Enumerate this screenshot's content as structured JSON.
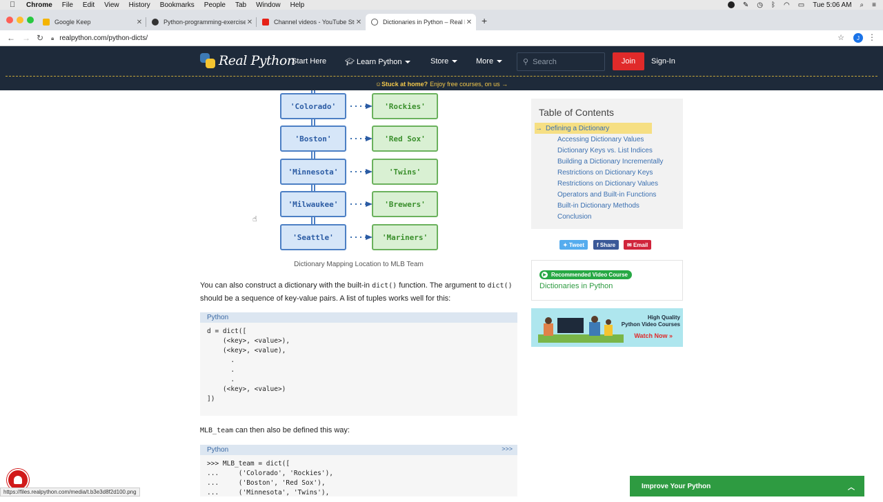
{
  "menubar": {
    "app": "Chrome",
    "items": [
      "File",
      "Edit",
      "View",
      "History",
      "Bookmarks",
      "People",
      "Tab",
      "Window",
      "Help"
    ],
    "clock": "Tue 5:06 AM"
  },
  "tabs": [
    {
      "title": "Google Keep",
      "color": "#f4b400"
    },
    {
      "title": "Python-programming-exercise",
      "color": "#333333"
    },
    {
      "title": "Channel videos - YouTube Stud",
      "color": "#e62117"
    },
    {
      "title": "Dictionaries in Python – Real P",
      "color": "#555555"
    }
  ],
  "address": {
    "url": "realpython.com/python-dicts/",
    "avatar": "J"
  },
  "site": {
    "logo": "Real Python",
    "nav": [
      "Start Here",
      "Learn Python",
      "Store",
      "More"
    ],
    "search_placeholder": "Search",
    "join": "Join",
    "signin": "Sign-In",
    "promo_bold": "Stuck at home?",
    "promo_text": "Enjoy free courses, on us →"
  },
  "diagram": {
    "keys": [
      "'Colorado'",
      "'Boston'",
      "'Minnesota'",
      "'Milwaukee'",
      "'Seattle'"
    ],
    "values": [
      "'Rockies'",
      "'Red Sox'",
      "'Twins'",
      "'Brewers'",
      "'Mariners'"
    ],
    "caption": "Dictionary Mapping Location to MLB Team"
  },
  "para1": {
    "a": "You can also construct a dictionary with the built-in ",
    "code1": "dict()",
    "b": " function. The argument to ",
    "code2": "dict()",
    "c": " should be a sequence of key-value pairs. A list of tuples works well for this:"
  },
  "code1": {
    "lang": "Python",
    "lines": [
      "d = dict([",
      "    (<key>, <value>),",
      "    (<key>, <value),",
      "      .",
      "      .",
      "      .",
      "    (<key>, <value>)",
      "])"
    ]
  },
  "para2": {
    "code": "MLB_team",
    "text": " can then also be defined this way:"
  },
  "code2": {
    "lang": "Python",
    "prompt": ">>>",
    "lines": [
      ">>> MLB_team = dict([",
      "...     ('Colorado', 'Rockies'),",
      "...     ('Boston', 'Red Sox'),",
      "...     ('Minnesota', 'Twins'),"
    ]
  },
  "toc": {
    "title": "Table of Contents",
    "items": [
      "Defining a Dictionary",
      "Accessing Dictionary Values",
      "Dictionary Keys vs. List Indices",
      "Building a Dictionary Incrementally",
      "Restrictions on Dictionary Keys",
      "Restrictions on Dictionary Values",
      "Operators and Built-in Functions",
      "Built-in Dictionary Methods",
      "Conclusion"
    ]
  },
  "share": {
    "tweet": "Tweet",
    "share": "Share",
    "email": "Email"
  },
  "recommended": {
    "badge": "Recommended Video Course",
    "title": "Dictionaries in Python"
  },
  "ad": {
    "line1": "High Quality",
    "line2": "Python Video Courses",
    "cta": "Watch Now »"
  },
  "status_url": "https://files.realpython.com/media/t.b3e3d8f2d100.png",
  "improve": "Improve Your Python",
  "colors": {
    "header": "#1e2a3a",
    "join": "#e02a2a",
    "green": "#2e9b41",
    "link": "#3a6fb0"
  }
}
